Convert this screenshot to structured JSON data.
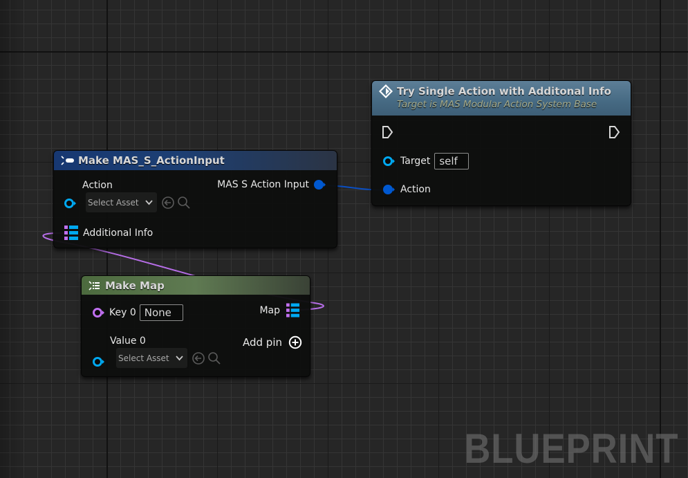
{
  "canvas": {
    "watermark": "BLUEPRINT",
    "colors": {
      "background": "#262626",
      "object_pin": "#00a8f0",
      "struct_pin": "#0058d0",
      "name_pin": "#c070f0",
      "map_wire": "#b76ee8",
      "struct_wire": "#0a4fc4",
      "exec_pin": "#d8d8d8"
    }
  },
  "nodes": {
    "try_action": {
      "title": "Try Single Action with Additonal Info",
      "subtitle": "Target is MAS Modular Action System Base",
      "icon": "function-icon",
      "pins": {
        "exec_in": "exec",
        "exec_out": "exec",
        "target_label": "Target",
        "target_value": "self",
        "action_label": "Action"
      }
    },
    "make_struct": {
      "title": "Make MAS_S_ActionInput",
      "icon": "make-struct-icon",
      "pins": {
        "action_label": "Action",
        "action_picker": "Select Asset",
        "output_label": "MAS S Action Input",
        "additional_info_label": "Additional Info"
      }
    },
    "make_map": {
      "title": "Make Map",
      "icon": "make-map-icon",
      "pins": {
        "key_label": "Key 0",
        "key_value": "None",
        "value_label": "Value 0",
        "value_picker": "Select Asset",
        "map_label": "Map",
        "add_pin_label": "Add pin"
      }
    }
  }
}
